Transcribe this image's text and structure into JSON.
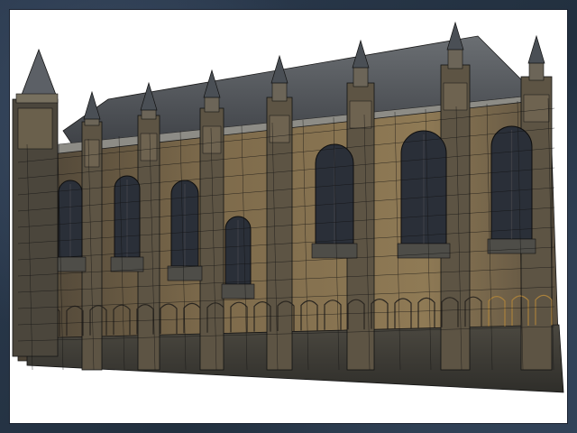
{
  "window": {
    "frame_color": "#2a3442",
    "viewport_color": "#ffffff"
  },
  "scene": {
    "subject_icon": "gothic-cathedral-wireframe-render",
    "stone_color": "#8a7452",
    "roof_color": "#4a4f55",
    "shadow_color": "#3c3a34",
    "window_color": "#2a2f38"
  }
}
